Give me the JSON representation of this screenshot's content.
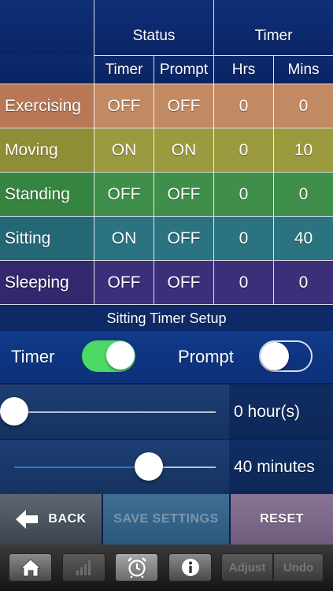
{
  "table": {
    "group_headers": {
      "status": "Status",
      "timer": "Timer"
    },
    "column_headers": {
      "timer": "Timer",
      "prompt": "Prompt",
      "hrs": "Hrs",
      "mins": "Mins"
    },
    "rows": [
      {
        "activity": "Exercising",
        "timer": "OFF",
        "prompt": "OFF",
        "hrs": "0",
        "mins": "0",
        "color": "#c28a63",
        "color_left": "#b87855"
      },
      {
        "activity": "Moving",
        "timer": "ON",
        "prompt": "ON",
        "hrs": "0",
        "mins": "10",
        "color": "#9c9a3e",
        "color_left": "#8f8d35"
      },
      {
        "activity": "Standing",
        "timer": "OFF",
        "prompt": "OFF",
        "hrs": "0",
        "mins": "0",
        "color": "#3f8f4a",
        "color_left": "#35843f"
      },
      {
        "activity": "Sitting",
        "timer": "ON",
        "prompt": "OFF",
        "hrs": "0",
        "mins": "40",
        "color": "#2c7381",
        "color_left": "#256875"
      },
      {
        "activity": "Sleeping",
        "timer": "OFF",
        "prompt": "OFF",
        "hrs": "0",
        "mins": "0",
        "color": "#3b2f7a",
        "color_left": "#33286d"
      }
    ]
  },
  "setup": {
    "title": "Sitting Timer Setup",
    "timer_label": "Timer",
    "timer_on": true,
    "prompt_label": "Prompt",
    "prompt_on": false,
    "hours_value": "0 hour(s)",
    "hours_fraction": 0,
    "minutes_value": "40 minutes",
    "minutes_fraction": 0.667
  },
  "actions": {
    "back": "BACK",
    "save": "SAVE SETTINGS",
    "reset": "RESET"
  },
  "toolbar": {
    "items": [
      {
        "name": "home-icon"
      },
      {
        "name": "chart-icon"
      },
      {
        "name": "alarm-clock-icon"
      },
      {
        "name": "info-icon"
      }
    ],
    "adjust": "Adjust",
    "undo": "Undo"
  },
  "colors": {
    "switch_on": "#4cd964",
    "slider_fill": "#2e6fe0",
    "header_blue": "#0f2f78"
  }
}
